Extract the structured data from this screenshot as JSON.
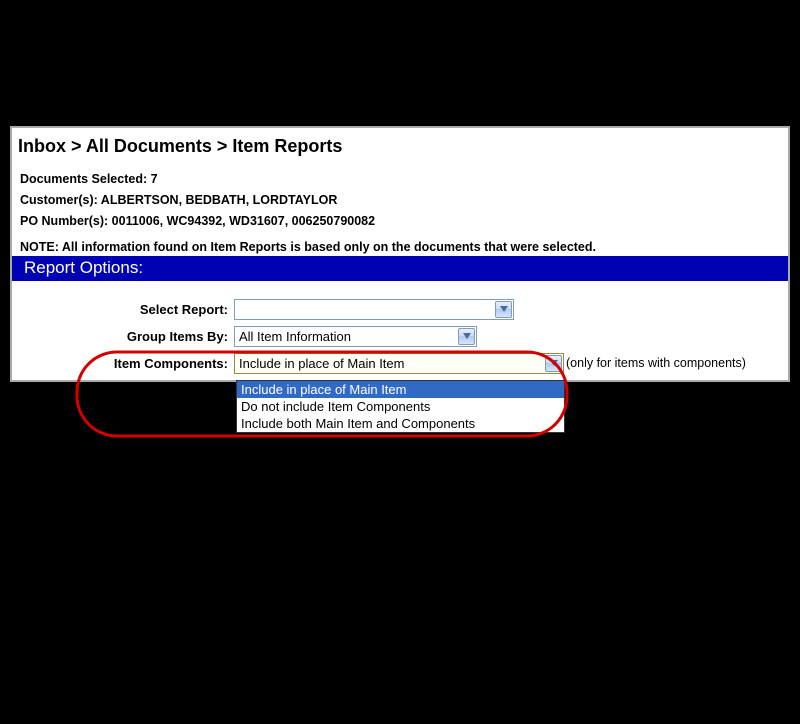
{
  "breadcrumb": "Inbox > All Documents > Item Reports",
  "meta": {
    "docs_selected": "Documents Selected: 7",
    "customers": "Customer(s): ALBERTSON, BEDBATH, LORDTAYLOR",
    "po_numbers": "PO Number(s): 0011006, WC94392, WD31607, 006250790082"
  },
  "note": "NOTE: All information found on Item Reports is based only on the documents that were selected.",
  "section_header": "Report Options:",
  "form": {
    "select_report": {
      "label": "Select Report:",
      "value": ""
    },
    "group_items": {
      "label": "Group Items By:",
      "value": "All Item Information"
    },
    "item_components": {
      "label": "Item Components:",
      "value": "Include in place of Main Item",
      "helper": "(only for items with components)",
      "options": [
        "Include in place of Main Item",
        "Do not include Item Components",
        "Include both Main Item and Components"
      ]
    }
  }
}
